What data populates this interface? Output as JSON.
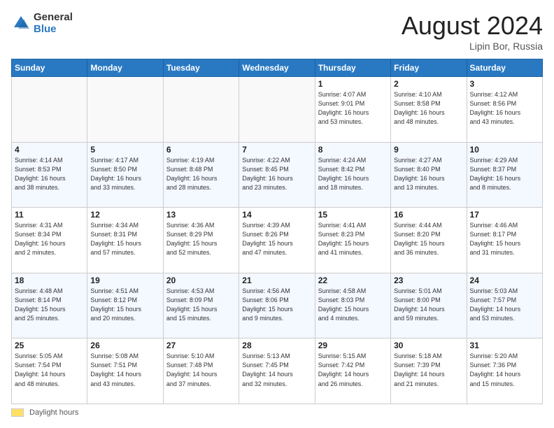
{
  "header": {
    "logo_general": "General",
    "logo_blue": "Blue",
    "month_year": "August 2024",
    "location": "Lipin Bor, Russia"
  },
  "weekdays": [
    "Sunday",
    "Monday",
    "Tuesday",
    "Wednesday",
    "Thursday",
    "Friday",
    "Saturday"
  ],
  "footer": {
    "legend_label": "Daylight hours"
  },
  "weeks": [
    [
      {
        "day": "",
        "info": ""
      },
      {
        "day": "",
        "info": ""
      },
      {
        "day": "",
        "info": ""
      },
      {
        "day": "",
        "info": ""
      },
      {
        "day": "1",
        "info": "Sunrise: 4:07 AM\nSunset: 9:01 PM\nDaylight: 16 hours\nand 53 minutes."
      },
      {
        "day": "2",
        "info": "Sunrise: 4:10 AM\nSunset: 8:58 PM\nDaylight: 16 hours\nand 48 minutes."
      },
      {
        "day": "3",
        "info": "Sunrise: 4:12 AM\nSunset: 8:56 PM\nDaylight: 16 hours\nand 43 minutes."
      }
    ],
    [
      {
        "day": "4",
        "info": "Sunrise: 4:14 AM\nSunset: 8:53 PM\nDaylight: 16 hours\nand 38 minutes."
      },
      {
        "day": "5",
        "info": "Sunrise: 4:17 AM\nSunset: 8:50 PM\nDaylight: 16 hours\nand 33 minutes."
      },
      {
        "day": "6",
        "info": "Sunrise: 4:19 AM\nSunset: 8:48 PM\nDaylight: 16 hours\nand 28 minutes."
      },
      {
        "day": "7",
        "info": "Sunrise: 4:22 AM\nSunset: 8:45 PM\nDaylight: 16 hours\nand 23 minutes."
      },
      {
        "day": "8",
        "info": "Sunrise: 4:24 AM\nSunset: 8:42 PM\nDaylight: 16 hours\nand 18 minutes."
      },
      {
        "day": "9",
        "info": "Sunrise: 4:27 AM\nSunset: 8:40 PM\nDaylight: 16 hours\nand 13 minutes."
      },
      {
        "day": "10",
        "info": "Sunrise: 4:29 AM\nSunset: 8:37 PM\nDaylight: 16 hours\nand 8 minutes."
      }
    ],
    [
      {
        "day": "11",
        "info": "Sunrise: 4:31 AM\nSunset: 8:34 PM\nDaylight: 16 hours\nand 2 minutes."
      },
      {
        "day": "12",
        "info": "Sunrise: 4:34 AM\nSunset: 8:31 PM\nDaylight: 15 hours\nand 57 minutes."
      },
      {
        "day": "13",
        "info": "Sunrise: 4:36 AM\nSunset: 8:29 PM\nDaylight: 15 hours\nand 52 minutes."
      },
      {
        "day": "14",
        "info": "Sunrise: 4:39 AM\nSunset: 8:26 PM\nDaylight: 15 hours\nand 47 minutes."
      },
      {
        "day": "15",
        "info": "Sunrise: 4:41 AM\nSunset: 8:23 PM\nDaylight: 15 hours\nand 41 minutes."
      },
      {
        "day": "16",
        "info": "Sunrise: 4:44 AM\nSunset: 8:20 PM\nDaylight: 15 hours\nand 36 minutes."
      },
      {
        "day": "17",
        "info": "Sunrise: 4:46 AM\nSunset: 8:17 PM\nDaylight: 15 hours\nand 31 minutes."
      }
    ],
    [
      {
        "day": "18",
        "info": "Sunrise: 4:48 AM\nSunset: 8:14 PM\nDaylight: 15 hours\nand 25 minutes."
      },
      {
        "day": "19",
        "info": "Sunrise: 4:51 AM\nSunset: 8:12 PM\nDaylight: 15 hours\nand 20 minutes."
      },
      {
        "day": "20",
        "info": "Sunrise: 4:53 AM\nSunset: 8:09 PM\nDaylight: 15 hours\nand 15 minutes."
      },
      {
        "day": "21",
        "info": "Sunrise: 4:56 AM\nSunset: 8:06 PM\nDaylight: 15 hours\nand 9 minutes."
      },
      {
        "day": "22",
        "info": "Sunrise: 4:58 AM\nSunset: 8:03 PM\nDaylight: 15 hours\nand 4 minutes."
      },
      {
        "day": "23",
        "info": "Sunrise: 5:01 AM\nSunset: 8:00 PM\nDaylight: 14 hours\nand 59 minutes."
      },
      {
        "day": "24",
        "info": "Sunrise: 5:03 AM\nSunset: 7:57 PM\nDaylight: 14 hours\nand 53 minutes."
      }
    ],
    [
      {
        "day": "25",
        "info": "Sunrise: 5:05 AM\nSunset: 7:54 PM\nDaylight: 14 hours\nand 48 minutes."
      },
      {
        "day": "26",
        "info": "Sunrise: 5:08 AM\nSunset: 7:51 PM\nDaylight: 14 hours\nand 43 minutes."
      },
      {
        "day": "27",
        "info": "Sunrise: 5:10 AM\nSunset: 7:48 PM\nDaylight: 14 hours\nand 37 minutes."
      },
      {
        "day": "28",
        "info": "Sunrise: 5:13 AM\nSunset: 7:45 PM\nDaylight: 14 hours\nand 32 minutes."
      },
      {
        "day": "29",
        "info": "Sunrise: 5:15 AM\nSunset: 7:42 PM\nDaylight: 14 hours\nand 26 minutes."
      },
      {
        "day": "30",
        "info": "Sunrise: 5:18 AM\nSunset: 7:39 PM\nDaylight: 14 hours\nand 21 minutes."
      },
      {
        "day": "31",
        "info": "Sunrise: 5:20 AM\nSunset: 7:36 PM\nDaylight: 14 hours\nand 15 minutes."
      }
    ]
  ]
}
